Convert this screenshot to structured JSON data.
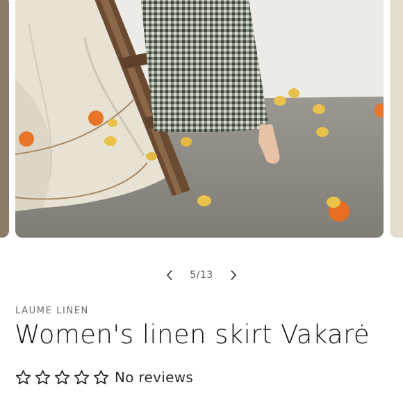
{
  "gallery": {
    "image_alt": "Model in checked linen skirt standing barefoot near a wooden ladder with oranges and lemons on the floor",
    "current_slide": 5,
    "total_slides": 13,
    "counter_text": "5/13",
    "prev_icon": "chevron-left-icon",
    "next_icon": "chevron-right-icon"
  },
  "product": {
    "vendor": "LAUME LINEN",
    "title": "Women's linen skirt Vakarė",
    "rating": {
      "stars": 0,
      "max_stars": 5,
      "star_icon": "star-outline-icon",
      "reviews_text": "No reviews"
    }
  }
}
